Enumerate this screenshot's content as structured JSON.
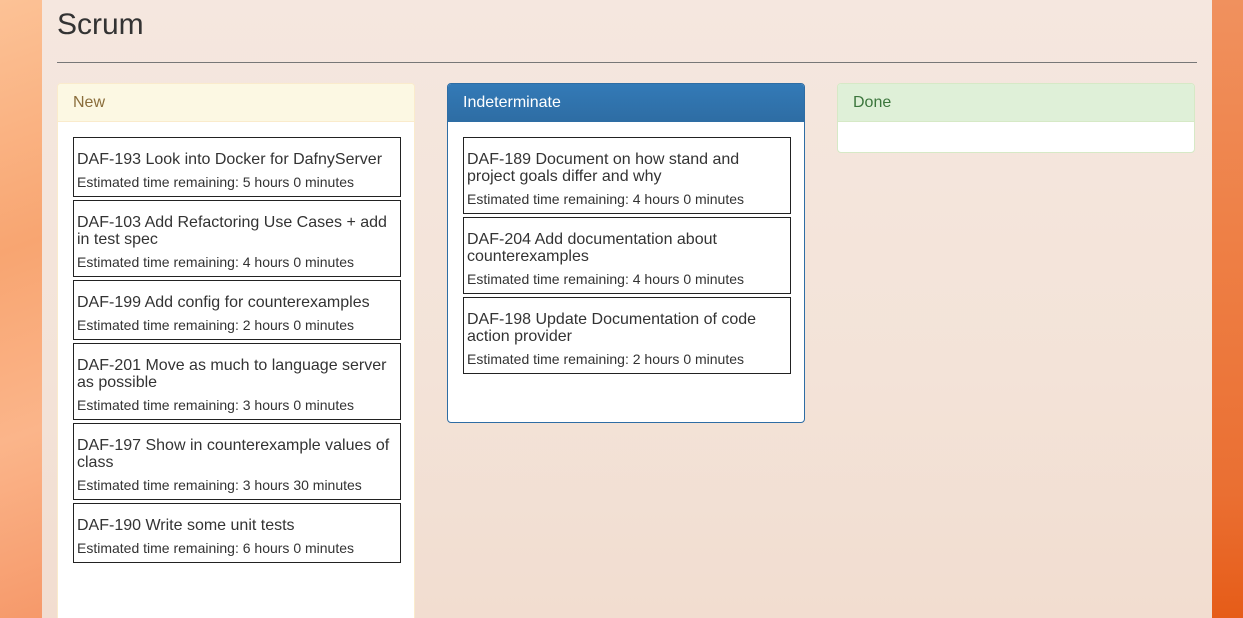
{
  "page": {
    "title": "Scrum"
  },
  "columns": {
    "new": {
      "label": "New",
      "cards": [
        {
          "title": "DAF-193 Look into Docker for DafnyServer",
          "estimate": "Estimated time remaining: 5 hours 0 minutes"
        },
        {
          "title": "DAF-103 Add Refactoring Use Cases + add in test spec",
          "estimate": "Estimated time remaining: 4 hours 0 minutes"
        },
        {
          "title": "DAF-199 Add config for counterexamples",
          "estimate": "Estimated time remaining: 2 hours 0 minutes"
        },
        {
          "title": "DAF-201 Move as much to language server as possible",
          "estimate": "Estimated time remaining: 3 hours 0 minutes"
        },
        {
          "title": "DAF-197 Show in counterexample values of class",
          "estimate": "Estimated time remaining: 3 hours 30 minutes"
        },
        {
          "title": "DAF-190 Write some unit tests",
          "estimate": "Estimated time remaining: 6 hours 0 minutes"
        }
      ]
    },
    "indeterminate": {
      "label": "Indeterminate",
      "cards": [
        {
          "title": "DAF-189 Document on how stand and project goals differ and why",
          "estimate": "Estimated time remaining: 4 hours 0 minutes"
        },
        {
          "title": "DAF-204 Add documentation about counterexamples",
          "estimate": "Estimated time remaining: 4 hours 0 minutes"
        },
        {
          "title": "DAF-198 Update Documentation of code action provider",
          "estimate": "Estimated time remaining: 2 hours 0 minutes"
        }
      ]
    },
    "done": {
      "label": "Done",
      "cards": []
    }
  }
}
